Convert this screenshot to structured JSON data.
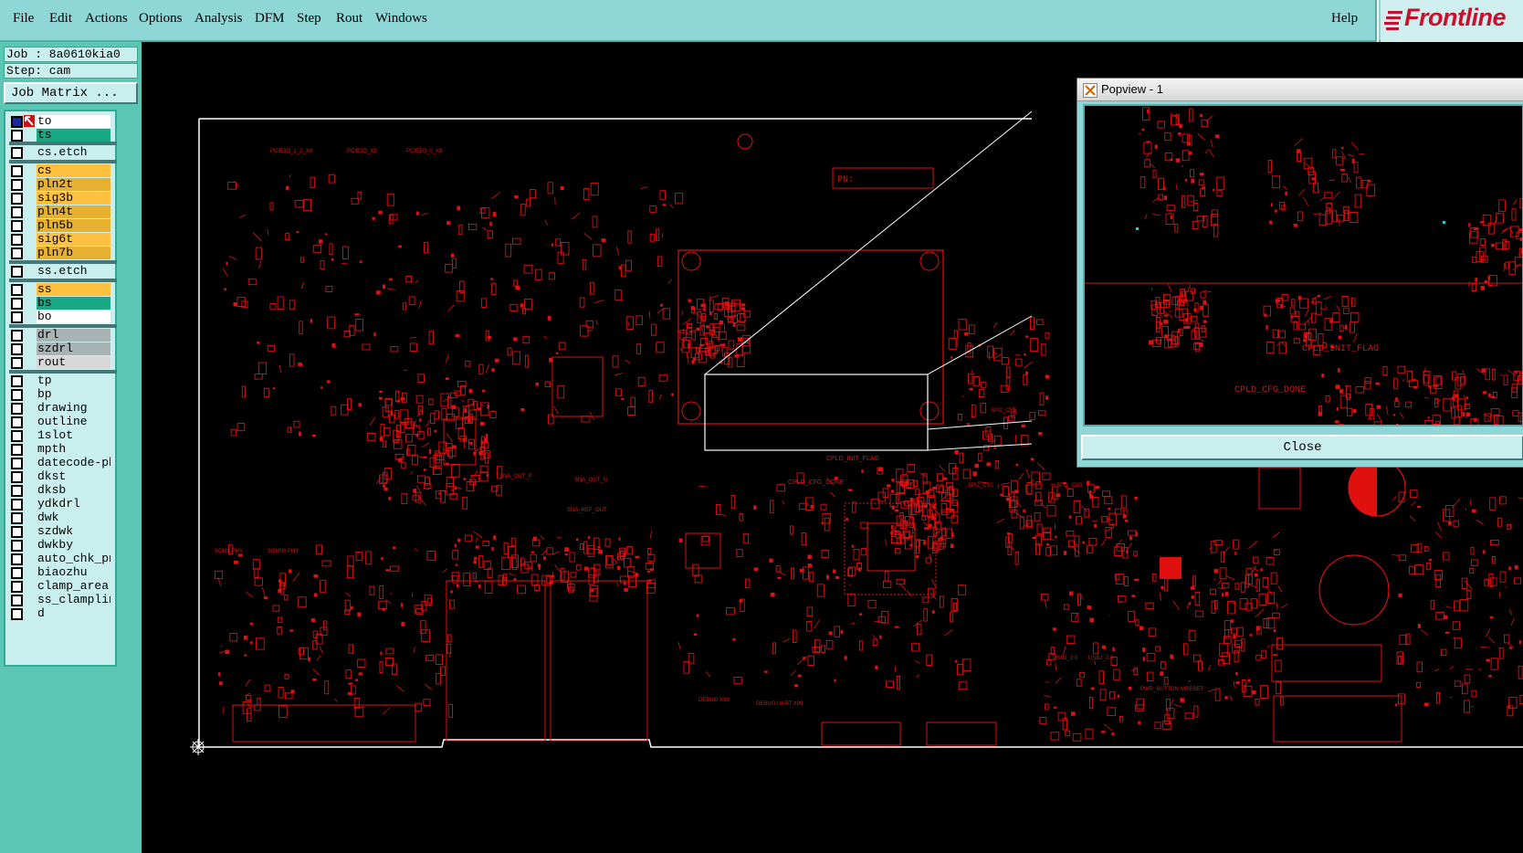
{
  "menu": {
    "items": [
      "File",
      "Edit",
      "Actions",
      "Options",
      "Analysis",
      "DFM",
      "Step",
      "Rout",
      "Windows"
    ],
    "help": "Help"
  },
  "logo": {
    "text": "Frontline",
    "color": "#c8102e"
  },
  "panel": {
    "job": "Job : 8a0610kia0",
    "step": "Step: cam",
    "job_matrix": "Job Matrix ..."
  },
  "layers": [
    {
      "name": "to",
      "color": "#ffffff"
    },
    {
      "name": "ts",
      "color": "#19a884"
    },
    {
      "name": "cs.etch",
      "color": "#c8eeee"
    },
    {
      "name": "cs",
      "color": "#ffc040"
    },
    {
      "name": "pln2t",
      "color": "#e6b030"
    },
    {
      "name": "sig3b",
      "color": "#ffc040"
    },
    {
      "name": "pln4t",
      "color": "#e6b030"
    },
    {
      "name": "pln5b",
      "color": "#e6b030"
    },
    {
      "name": "sig6t",
      "color": "#ffc040"
    },
    {
      "name": "pln7b",
      "color": "#e6b030"
    },
    {
      "name": "ss.etch",
      "color": "#c8eeee"
    },
    {
      "name": "ss",
      "color": "#ffc040"
    },
    {
      "name": "bs",
      "color": "#19a884"
    },
    {
      "name": "bo",
      "color": "#ffffff"
    },
    {
      "name": "drl",
      "color": "#a8b4b4"
    },
    {
      "name": "szdrl",
      "color": "#a8b4b4"
    },
    {
      "name": "rout",
      "color": "#d8d8d8"
    },
    {
      "name": "tp",
      "color": "#c8eeee"
    },
    {
      "name": "bp",
      "color": "#c8eeee"
    },
    {
      "name": "drawing",
      "color": "#c8eeee"
    },
    {
      "name": "outline",
      "color": "#c8eeee"
    },
    {
      "name": "1slot",
      "color": "#c8eeee"
    },
    {
      "name": "mpth",
      "color": "#c8eeee"
    },
    {
      "name": "datecode-pbo",
      "color": "#c8eeee"
    },
    {
      "name": "dkst",
      "color": "#c8eeee"
    },
    {
      "name": "dksb",
      "color": "#c8eeee"
    },
    {
      "name": "ydkdrl",
      "color": "#c8eeee"
    },
    {
      "name": "dwk",
      "color": "#c8eeee"
    },
    {
      "name": "szdwk",
      "color": "#c8eeee"
    },
    {
      "name": "dwkby",
      "color": "#c8eeee"
    },
    {
      "name": "auto_chk_pnl",
      "color": "#c8eeee"
    },
    {
      "name": "biaozhu",
      "color": "#c8eeee"
    },
    {
      "name": "clamp_area",
      "color": "#c8eeee"
    },
    {
      "name": "ss_clampline",
      "color": "#c8eeee"
    },
    {
      "name": "d",
      "color": "#c8eeee"
    }
  ],
  "board": {
    "labels": {
      "pn": "PN:",
      "cpld_init": "CPLD_INIT_FLAG",
      "cpld_cfg": "CPLD_CFG_DONE",
      "sna_out_p": "SNA_OUT_P",
      "sna_out_n": "SNA_OUT_N",
      "sna_ref": "SNA_REF_OUT",
      "spi2_cs0": "SPI2_CS0",
      "spi1_cs0": "SPI1_CS0",
      "spi2_cs2": "SPI2_CS2",
      "pcie_1": "PCIE3O_1_2_X8",
      "pcie_2": "PCIE2O_X8",
      "pcie_3": "PCIE3O_0_X8",
      "sgmii_phy": "SGMII PHY",
      "sgmii_d": "SGMII0 PHY",
      "mdc": "MDC.ETH",
      "usb1": "USB1_2.0",
      "usb2": "USB2_2.0",
      "pwr_btn": "PWR_BUTTON",
      "mreset": "MRESET",
      "debug_1": "DEBUG X99",
      "debug_2": "DEBUG UART X99"
    },
    "trace_color": "#e01010",
    "outline_color": "#ffffff"
  },
  "popview": {
    "title": "Popview - 1",
    "close": "Close",
    "labels": {
      "init": "CPLD_INIT_FLAG",
      "cfg": "CPLD_CFG_DONE"
    }
  }
}
